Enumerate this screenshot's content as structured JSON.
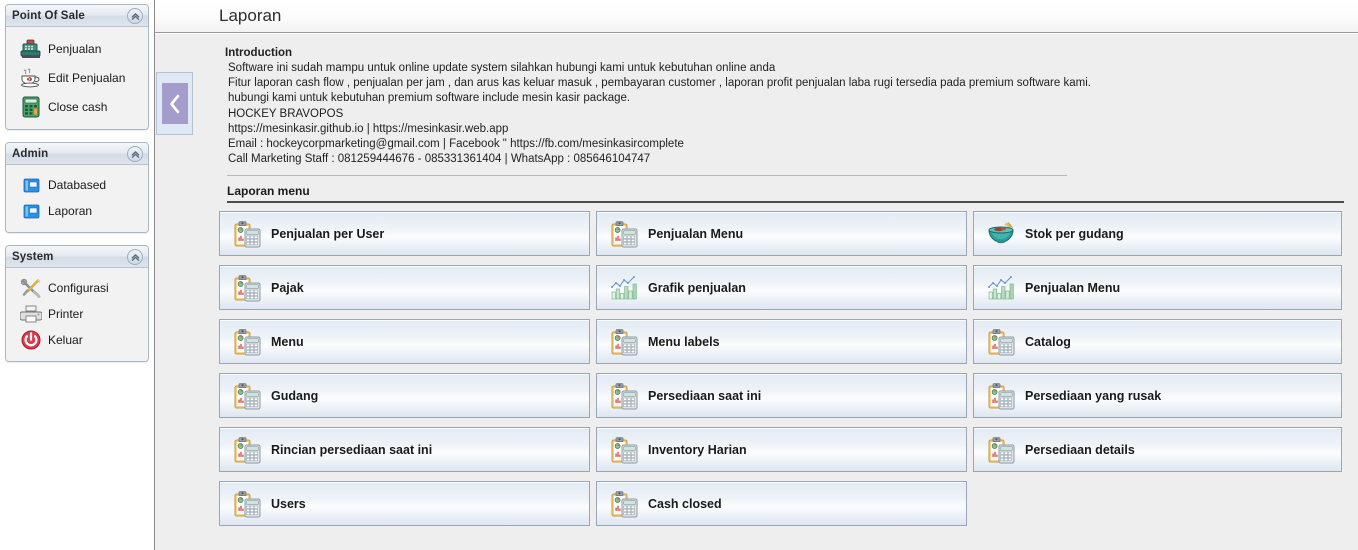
{
  "app": {
    "page_title": "Laporan"
  },
  "sidebar": {
    "panels": [
      {
        "title": "Point Of Sale",
        "collapse_icon": "chevron-up-icon",
        "items": [
          {
            "label": "Penjualan",
            "icon": "cash-register-icon"
          },
          {
            "label": "Edit Penjualan",
            "icon": "coffee-cup-icon"
          },
          {
            "label": "Close cash",
            "icon": "calculator-icon"
          }
        ]
      },
      {
        "title": "Admin",
        "collapse_icon": "chevron-up-icon",
        "items": [
          {
            "label": "Databased",
            "icon": "database-card-icon"
          },
          {
            "label": "Laporan",
            "icon": "database-card-icon"
          }
        ]
      },
      {
        "title": "System",
        "collapse_icon": "chevron-up-icon",
        "items": [
          {
            "label": "Configurasi",
            "icon": "tools-icon"
          },
          {
            "label": "Printer",
            "icon": "printer-icon"
          },
          {
            "label": "Keluar",
            "icon": "power-icon"
          }
        ]
      }
    ]
  },
  "toggle": {
    "icon": "chevron-left-icon",
    "color": "#a49ccb"
  },
  "intro": {
    "heading": "Introduction",
    "lines": [
      "Software ini sudah mampu untuk online update system silahkan hubungi kami untuk kebutuhan online anda",
      "Fitur laporan cash flow , penjualan per jam , dan arus kas keluar masuk , pembayaran customer , laporan profit penjualan laba rugi tersedia pada premium software kami.",
      "hubungi kami untuk kebutuhan premium software include mesin kasir package.",
      "HOCKEY BRAVOPOS",
      "https://mesinkasir.github.io | https://mesinkasir.web.app",
      "Email : hockeycorpmarketing@gmail.com | Facebook \" https://fb.com/mesinkasircomplete",
      "Call Marketing Staff : 081259444676 - 085331361404 | WhatsApp : 085646104747"
    ]
  },
  "report_menu": {
    "section_label": "Laporan menu",
    "columns": [
      {
        "tiles": [
          {
            "label": "Penjualan per User",
            "icon": "clipboard-calculator-icon"
          },
          {
            "label": "Pajak",
            "icon": "clipboard-calculator-icon"
          },
          {
            "label": "Menu",
            "icon": "clipboard-calculator-icon"
          },
          {
            "label": "Gudang",
            "icon": "clipboard-calculator-icon"
          },
          {
            "label": "Rincian persediaan saat ini",
            "icon": "clipboard-calculator-icon"
          },
          {
            "label": "Users",
            "icon": "clipboard-calculator-icon"
          }
        ]
      },
      {
        "tiles": [
          {
            "label": "Penjualan Menu",
            "icon": "clipboard-calculator-icon"
          },
          {
            "label": "Grafik penjualan",
            "icon": "bar-chart-icon"
          },
          {
            "label": "Menu labels",
            "icon": "clipboard-calculator-icon"
          },
          {
            "label": "Persediaan saat ini",
            "icon": "clipboard-calculator-icon"
          },
          {
            "label": "Inventory Harian",
            "icon": "clipboard-calculator-icon"
          },
          {
            "label": "Cash closed",
            "icon": "clipboard-calculator-icon"
          }
        ]
      },
      {
        "tiles": [
          {
            "label": "Stok per gudang",
            "icon": "noodle-bowl-icon"
          },
          {
            "label": "Penjualan Menu",
            "icon": "bar-chart-icon"
          },
          {
            "label": "Catalog",
            "icon": "clipboard-calculator-icon"
          },
          {
            "label": "Persediaan yang rusak",
            "icon": "clipboard-calculator-icon"
          },
          {
            "label": "Persediaan details",
            "icon": "clipboard-calculator-icon"
          },
          {
            "label": "",
            "icon": "",
            "empty": true
          }
        ]
      }
    ]
  }
}
